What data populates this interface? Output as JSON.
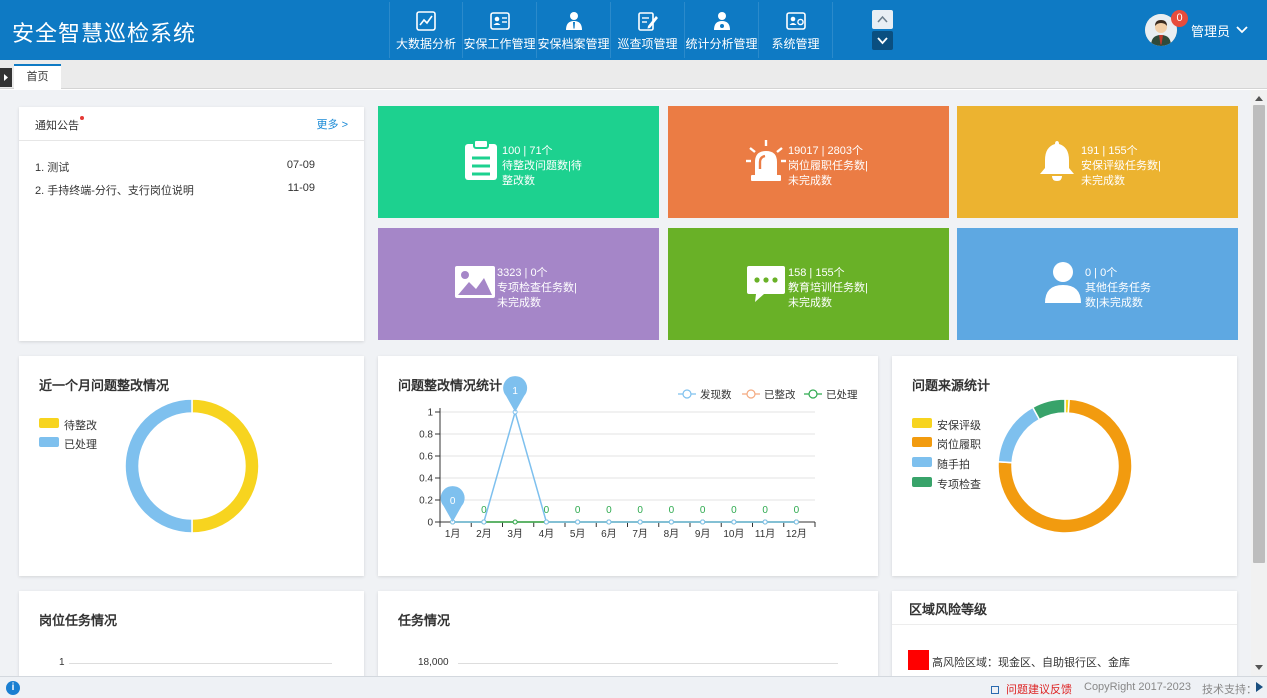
{
  "header": {
    "title": "安全智慧巡检系统",
    "nav": [
      {
        "label": "大数据分析",
        "icon": "chart-icon"
      },
      {
        "label": "安保工作管理",
        "icon": "id-card-icon"
      },
      {
        "label": "安保档案管理",
        "icon": "user-tie-icon"
      },
      {
        "label": "巡查项管理",
        "icon": "edit-icon"
      },
      {
        "label": "统计分析管理",
        "icon": "user-icon"
      },
      {
        "label": "系统管理",
        "icon": "id-card-icon"
      }
    ],
    "user": {
      "name": "管理员",
      "badge": "0"
    }
  },
  "tabs": {
    "home": "首页"
  },
  "notice": {
    "title": "通知公告",
    "more": "更多 >",
    "items": [
      {
        "text": "1. 测试",
        "date": "07-09"
      },
      {
        "text": "2. 手持终端-分行、支行岗位说明",
        "date": "11-09"
      }
    ]
  },
  "tiles": [
    {
      "line1": "100 | 71个",
      "line2": "待整改问题数|待",
      "line3": "整改数",
      "color": "#1dd18f",
      "icon": "clipboard-icon"
    },
    {
      "line1": "19017 | 2803个",
      "line2": "岗位履职任务数|",
      "line3": "未完成数",
      "color": "#eb7c44",
      "icon": "alarm-light-icon"
    },
    {
      "line1": "191 | 155个",
      "line2": "安保评级任务数|",
      "line3": "未完成数",
      "color": "#ecb330",
      "icon": "bell-icon"
    },
    {
      "line1": "3323 | 0个",
      "line2": "专项检查任务数|",
      "line3": "未完成数",
      "color": "#a586c8",
      "icon": "image-icon"
    },
    {
      "line1": "158 | 155个",
      "line2": "教育培训任务数|",
      "line3": "未完成数",
      "color": "#69b127",
      "icon": "chat-icon"
    },
    {
      "line1": "0 | 0个",
      "line2": "其他任务任务",
      "line3": "数|未完成数",
      "color": "#5ea8e2",
      "icon": "user-icon"
    }
  ],
  "panels": {
    "rectify_month": "近一个月问题整改情况",
    "rectify_stats": "问题整改情况统计",
    "source_stats": "问题来源统计",
    "post_task": "岗位任务情况",
    "task": "任务情况",
    "region_risk": "区域风险等级"
  },
  "chart_data": [
    {
      "type": "pie",
      "title": "近一个月问题整改情况",
      "donut": true,
      "categories": [
        "待整改",
        "已处理"
      ],
      "values": [
        50,
        50
      ],
      "colors": [
        "#f7d41f",
        "#7ec0ee"
      ],
      "legend": "left"
    },
    {
      "type": "line",
      "title": "问题整改情况统计",
      "categories": [
        "1月",
        "2月",
        "3月",
        "4月",
        "5月",
        "6月",
        "7月",
        "8月",
        "9月",
        "10月",
        "11月",
        "12月"
      ],
      "series": [
        {
          "name": "发现数",
          "values": [
            0,
            0,
            1,
            0,
            0,
            0,
            0,
            0,
            0,
            0,
            0,
            0
          ],
          "color": "#7ec0ee"
        },
        {
          "name": "已整改",
          "values": [
            0,
            0,
            0,
            0,
            0,
            0,
            0,
            0,
            0,
            0,
            0,
            0
          ],
          "color": "#f4a97f"
        },
        {
          "name": "已处理",
          "values": [
            0,
            0,
            0,
            0,
            0,
            0,
            0,
            0,
            0,
            0,
            0,
            0
          ],
          "color": "#2eaa4f"
        }
      ],
      "data_labels": [
        "0",
        "0",
        "1",
        "0",
        "0",
        "0",
        "0",
        "0",
        "0",
        "0",
        "0",
        "0"
      ],
      "ylim": [
        0,
        1
      ],
      "yticks": [
        "0",
        "0.2",
        "0.4",
        "0.6",
        "0.8",
        "1"
      ],
      "grid": true,
      "legend": "top-right"
    },
    {
      "type": "pie",
      "title": "问题来源统计",
      "donut": true,
      "categories": [
        "安保评级",
        "岗位履职",
        "随手拍",
        "专项检查"
      ],
      "values": [
        1,
        75,
        16,
        8
      ],
      "colors": [
        "#f7d41f",
        "#f29b0f",
        "#7ec0ee",
        "#38a36a"
      ],
      "legend": "left"
    },
    {
      "type": "bar",
      "title": "岗位任务情况",
      "yticks": [
        "1"
      ],
      "categories": [],
      "values": []
    },
    {
      "type": "bar",
      "title": "任务情况",
      "yticks": [
        "18,000"
      ],
      "categories": [],
      "values": []
    }
  ],
  "region": {
    "items": [
      {
        "label": "高风险区域：现金区、自助银行区、金库",
        "color": "#ff0000"
      }
    ]
  },
  "statusbar": {
    "feedback": "问题建议反馈",
    "copyright": "CopyRight 2017-2023",
    "support": "技术支持："
  }
}
